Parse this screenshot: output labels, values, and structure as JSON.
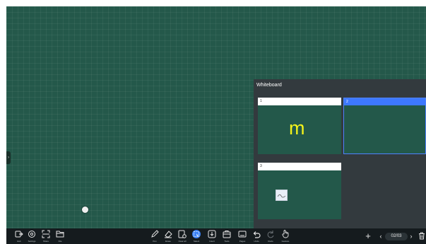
{
  "panel": {
    "title": "Whiteboard",
    "pages": [
      {
        "number": "1",
        "content": "m"
      },
      {
        "number": "2"
      },
      {
        "number": "3"
      }
    ]
  },
  "toolbar": {
    "left": [
      {
        "label": "Exit",
        "icon": "exit-icon"
      },
      {
        "label": "Settings",
        "icon": "settings-icon"
      },
      {
        "label": "Share",
        "icon": "share-icon"
      },
      {
        "label": "File",
        "icon": "folder-icon"
      }
    ],
    "center": [
      {
        "label": "Pen",
        "icon": "pen-icon"
      },
      {
        "label": "Erase",
        "icon": "eraser-icon"
      },
      {
        "label": "Clear all",
        "icon": "clear-all-icon"
      },
      {
        "label": "Select",
        "icon": "select-icon",
        "active": true
      },
      {
        "label": "Insert",
        "icon": "insert-icon"
      },
      {
        "label": "Tools",
        "icon": "tools-icon"
      },
      {
        "label": "Pages",
        "icon": "pages-icon"
      },
      {
        "label": "Undo",
        "icon": "undo-icon"
      },
      {
        "label": "Redo",
        "icon": "redo-icon"
      },
      {
        "label": "Gesture",
        "icon": "hand-icon"
      }
    ],
    "right": {
      "add": "+",
      "prev": "‹",
      "page_count": "02/03",
      "next": "›",
      "delete_icon": "trash-icon"
    }
  },
  "colors": {
    "board": "#24584a",
    "panel": "#333a3e",
    "accent": "#3d78ff",
    "ink": "#f3f31b",
    "toolbar": "#151b1e"
  }
}
